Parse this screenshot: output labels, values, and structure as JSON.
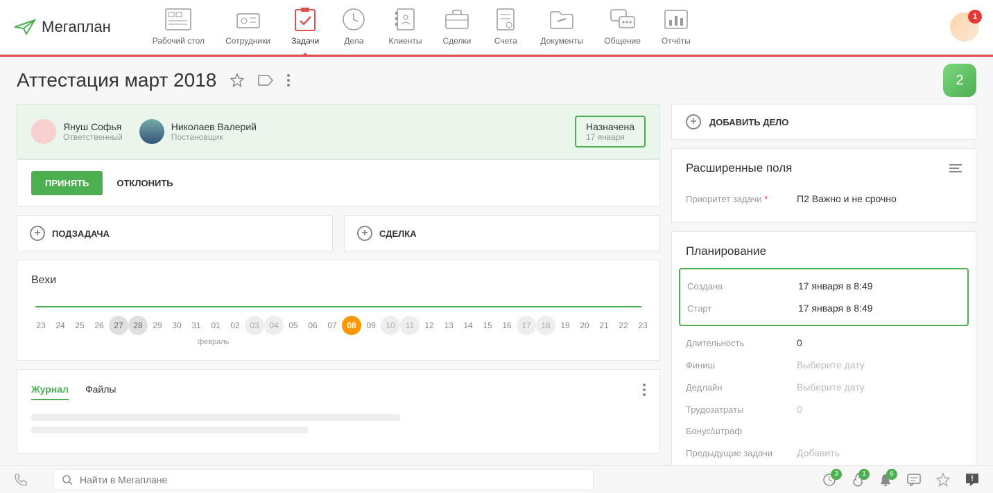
{
  "logo_text": "Мегаплан",
  "nav": [
    {
      "label": "Рабочий стол"
    },
    {
      "label": "Сотрудники"
    },
    {
      "label": "Задачи"
    },
    {
      "label": "Дела"
    },
    {
      "label": "Клиенты"
    },
    {
      "label": "Сделки"
    },
    {
      "label": "Счета"
    },
    {
      "label": "Документы"
    },
    {
      "label": "Общение"
    },
    {
      "label": "Отчёты"
    }
  ],
  "header_badge": "1",
  "page_title": "Аттестация март 2018",
  "green_badge": "2",
  "people": {
    "responsible": {
      "name": "Януш Софья",
      "role": "Ответственный"
    },
    "author": {
      "name": "Николаев Валерий",
      "role": "Постановщик"
    }
  },
  "status": {
    "label": "Назначена",
    "date": "17 января"
  },
  "actions": {
    "accept": "ПРИНЯТЬ",
    "reject": "ОТКЛОНИТЬ"
  },
  "add_buttons": {
    "subtask": "ПОДЗАДАЧА",
    "deal": "СДЕЛКА"
  },
  "milestones": {
    "title": "Вехи",
    "month_label": "февраль",
    "days": [
      {
        "n": "23"
      },
      {
        "n": "24"
      },
      {
        "n": "25"
      },
      {
        "n": "26"
      },
      {
        "n": "27",
        "style": "gray"
      },
      {
        "n": "28",
        "style": "gray"
      },
      {
        "n": "29"
      },
      {
        "n": "30"
      },
      {
        "n": "31"
      },
      {
        "n": "01"
      },
      {
        "n": "02"
      },
      {
        "n": "03",
        "style": "muted"
      },
      {
        "n": "04",
        "style": "muted"
      },
      {
        "n": "05"
      },
      {
        "n": "06"
      },
      {
        "n": "07"
      },
      {
        "n": "08",
        "style": "current"
      },
      {
        "n": "09"
      },
      {
        "n": "10",
        "style": "muted"
      },
      {
        "n": "11",
        "style": "muted"
      },
      {
        "n": "12"
      },
      {
        "n": "13"
      },
      {
        "n": "14"
      },
      {
        "n": "15"
      },
      {
        "n": "16"
      },
      {
        "n": "17",
        "style": "muted"
      },
      {
        "n": "18",
        "style": "muted"
      },
      {
        "n": "19"
      },
      {
        "n": "20"
      },
      {
        "n": "21"
      },
      {
        "n": "22"
      },
      {
        "n": "23"
      }
    ]
  },
  "journal": {
    "tab1": "Журнал",
    "tab2": "Файлы"
  },
  "right": {
    "add_deal": "ДОБАВИТЬ ДЕЛО",
    "ext_title": "Расширенные поля",
    "priority_label": "Приоритет задачи",
    "priority_value": "П2 Важно и не срочно",
    "planning_title": "Планирование",
    "created_label": "Создана",
    "created_value": "17 января в 8:49",
    "start_label": "Старт",
    "start_value": "17 января в 8:49",
    "duration_label": "Длительность",
    "duration_value": "0",
    "finish_label": "Финиш",
    "finish_placeholder": "Выберите дату",
    "deadline_label": "Дедлайн",
    "deadline_placeholder": "Выберите дату",
    "effort_label": "Трудозатраты",
    "effort_value": "0",
    "bonus_label": "Бонус/штраф",
    "prev_label": "Предыдущие задачи",
    "prev_placeholder": "Добавить"
  },
  "footer": {
    "search_placeholder": "Найти в Мегаплане",
    "badges": {
      "clock": "3",
      "fire": "1",
      "bell": "6"
    }
  }
}
